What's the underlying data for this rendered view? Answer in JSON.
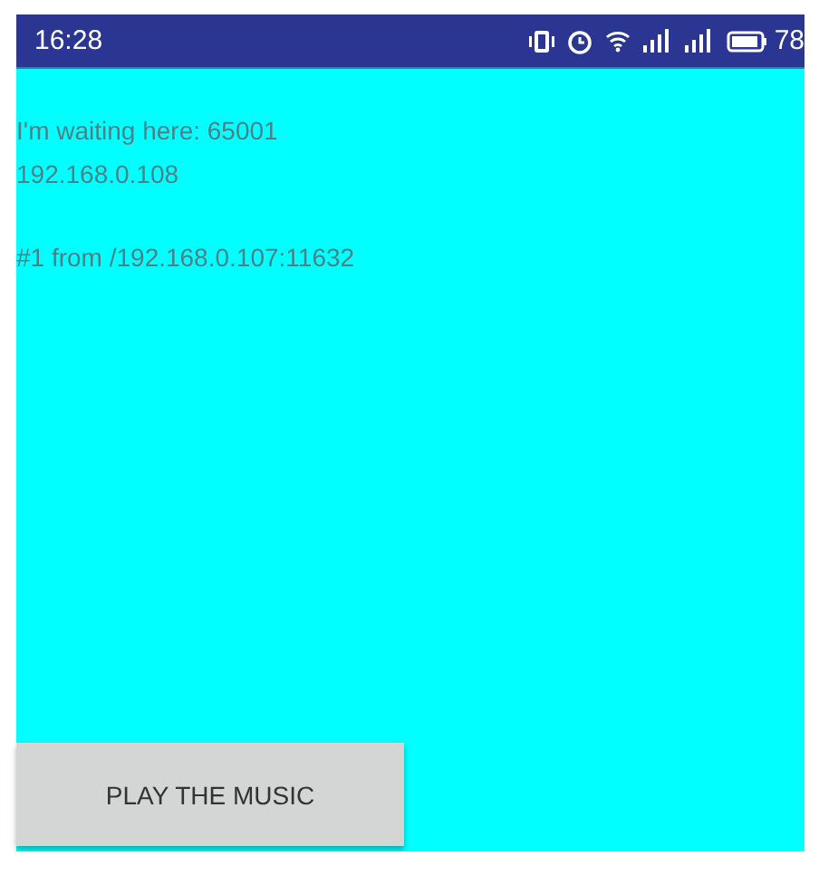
{
  "status_bar": {
    "time": "16:28",
    "battery_text": "78"
  },
  "messages": [
    "I'm waiting here: 65001",
    "192.168.0.108",
    "#1 from /192.168.0.107:11632"
  ],
  "buttons": [
    "PLAY THE MUSIC"
  ]
}
